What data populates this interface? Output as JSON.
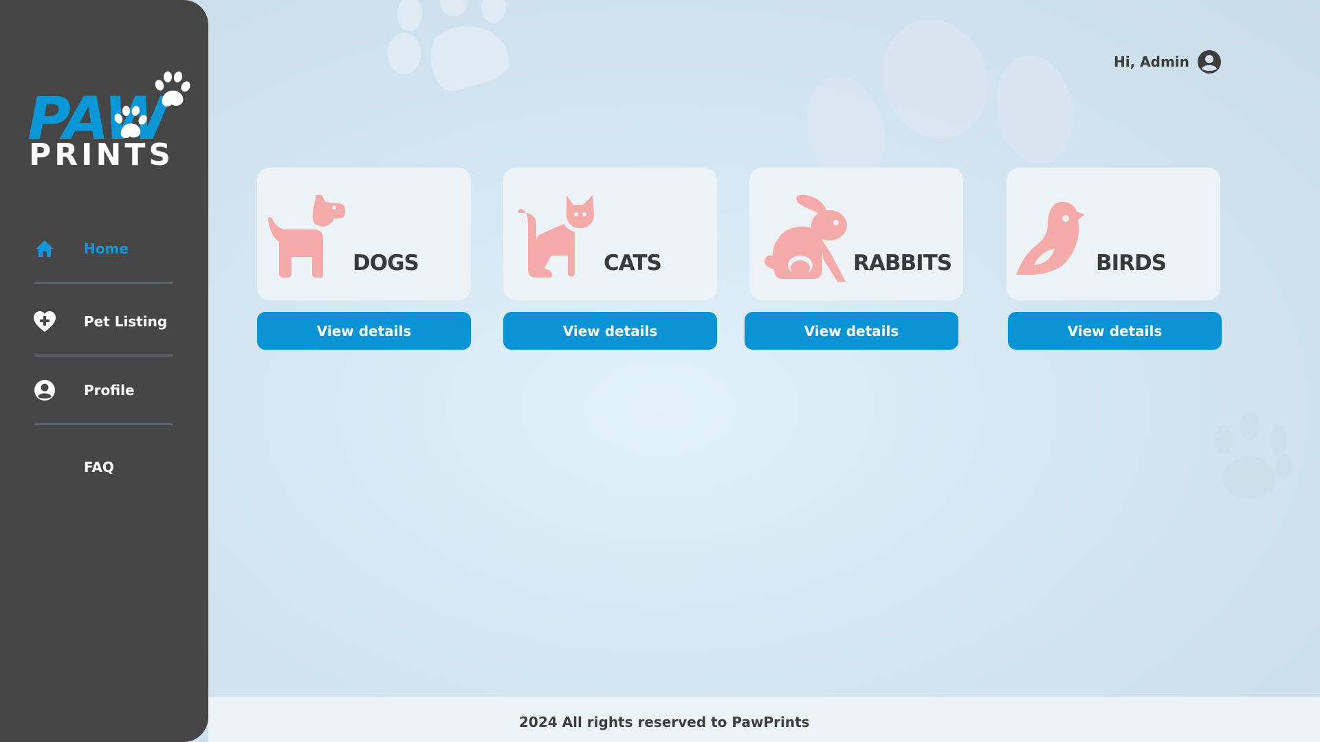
{
  "brand": {
    "logo_top": "PAW",
    "logo_bottom": "PRINTS",
    "accent": "#0997d8",
    "sidebar_bg": "#464646",
    "card_icon_color": "#f4aaa8"
  },
  "header": {
    "greeting": "Hi, Admin",
    "avatar_icon": "user-circle-icon"
  },
  "sidebar": {
    "items": [
      {
        "label": "Home",
        "icon": "home-icon",
        "active": true
      },
      {
        "label": "Pet Listing",
        "icon": "heart-plus-icon",
        "active": false
      },
      {
        "label": "Profile",
        "icon": "user-circle-icon",
        "active": false
      },
      {
        "label": "FAQ",
        "icon": "",
        "active": false
      }
    ]
  },
  "categories": [
    {
      "title": "DOGS",
      "icon": "dog-icon",
      "button": "View details"
    },
    {
      "title": "CATS",
      "icon": "cat-icon",
      "button": "View details"
    },
    {
      "title": "RABBITS",
      "icon": "rabbit-icon",
      "button": "View details"
    },
    {
      "title": "BIRDS",
      "icon": "bird-icon",
      "button": "View details"
    }
  ],
  "footer": {
    "text": "2024 All rights reserved to PawPrints"
  }
}
